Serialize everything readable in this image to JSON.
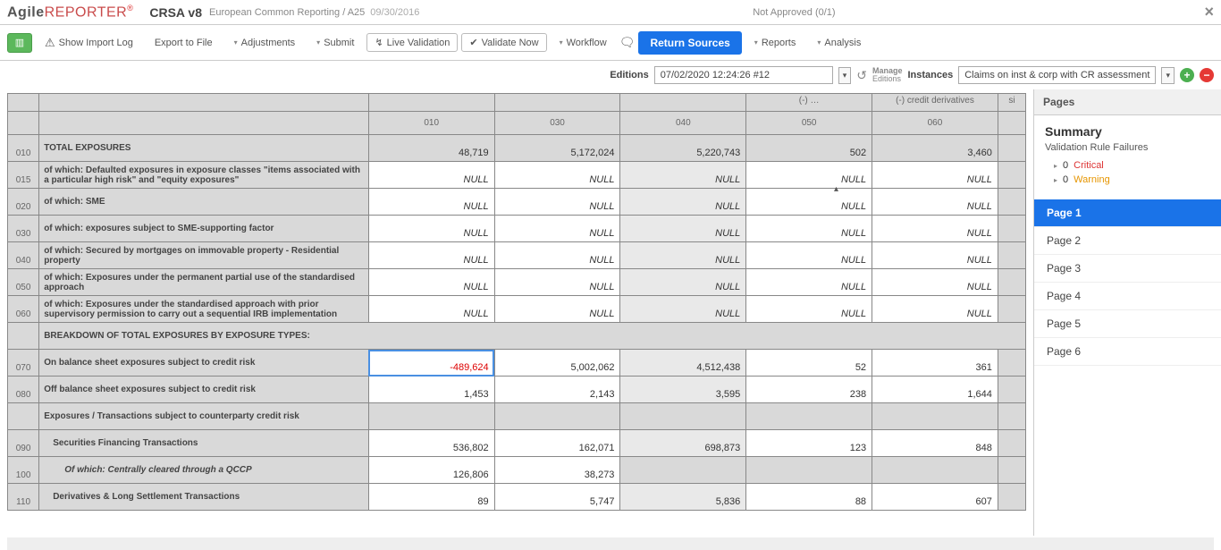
{
  "header": {
    "logo_a": "Agile",
    "logo_b": "REPORTER",
    "logo_reg": "®",
    "product": "CRSA v8",
    "path": "European Common Reporting / A25",
    "date": "09/30/2016",
    "status": "Not Approved (0/1)"
  },
  "toolbar": {
    "import_log": "Show Import Log",
    "export": "Export to File",
    "adjust": "Adjustments",
    "submit": "Submit",
    "live_val": "Live Validation",
    "val_now": "Validate Now",
    "workflow": "Workflow",
    "ret_sources": "Return Sources",
    "reports": "Reports",
    "analysis": "Analysis"
  },
  "subbar": {
    "editions": "Editions",
    "edition_sel": "07/02/2020 12:24:26 #12",
    "manage_top": "Manage",
    "manage_bot": "Editions",
    "instances": "Instances",
    "instance_sel": "Claims on inst & corp with CR assessment"
  },
  "table": {
    "col_headers_partial": {
      "c050": "(-) …",
      "c060": "(-) credit derivatives",
      "extra": "si"
    },
    "col_codes": [
      "010",
      "030",
      "040",
      "050",
      "060"
    ],
    "rows": [
      {
        "code": "010",
        "label": "TOTAL EXPOSURES",
        "type": "grey",
        "data": [
          "48,719",
          "5,172,024",
          "5,220,743",
          "502",
          "3,460"
        ]
      },
      {
        "code": "015",
        "label": "of which: Defaulted exposures in exposure classes \"items associated with a particular high risk\" and \"equity exposures\"",
        "type": "null"
      },
      {
        "code": "020",
        "label": "of which: SME",
        "type": "null"
      },
      {
        "code": "030",
        "label": "of which: exposures subject to SME-supporting factor",
        "type": "null"
      },
      {
        "code": "040",
        "label": "of which: Secured by mortgages on immovable property - Residential property",
        "type": "null"
      },
      {
        "code": "050",
        "label": "of which: Exposures under the permanent partial use of the standardised approach",
        "type": "null"
      },
      {
        "code": "060",
        "label": "of which: Exposures under the standardised approach with prior supervisory permission to carry out a sequential IRB implementation",
        "type": "null"
      },
      {
        "code": "",
        "label": "BREAKDOWN OF TOTAL EXPOSURES BY EXPOSURE TYPES:",
        "type": "section"
      },
      {
        "code": "070",
        "label": "On balance sheet exposures subject to credit risk",
        "type": "data",
        "data": [
          "-489,624",
          "5,002,062",
          "4,512,438",
          "52",
          "361"
        ],
        "neg0": true,
        "sel0": true
      },
      {
        "code": "080",
        "label": "Off balance sheet exposures subject to credit risk",
        "type": "data",
        "data": [
          "1,453",
          "2,143",
          "3,595",
          "238",
          "1,644"
        ]
      },
      {
        "code": "",
        "label": "Exposures / Transactions subject to counterparty credit risk",
        "type": "sub_section"
      },
      {
        "code": "090",
        "label": "Securities Financing Transactions",
        "type": "data",
        "indent": 1,
        "data": [
          "536,802",
          "162,071",
          "698,873",
          "123",
          "848"
        ]
      },
      {
        "code": "100",
        "label": "Of which: Centrally cleared through a QCCP",
        "type": "partial",
        "indent": 2,
        "data": [
          "126,806",
          "38,273",
          "",
          "",
          ""
        ]
      },
      {
        "code": "110",
        "label": "Derivatives & Long Settlement Transactions",
        "type": "data",
        "indent": 1,
        "data": [
          "89",
          "5,747",
          "5,836",
          "88",
          "607"
        ]
      }
    ]
  },
  "side": {
    "pages_title": "Pages",
    "summary": "Summary",
    "subtitle": "Validation Rule Failures",
    "crit_count": "0",
    "crit_label": "Critical",
    "warn_count": "0",
    "warn_label": "Warning",
    "pages": [
      "Page 1",
      "Page 2",
      "Page 3",
      "Page 4",
      "Page 5",
      "Page 6"
    ]
  }
}
